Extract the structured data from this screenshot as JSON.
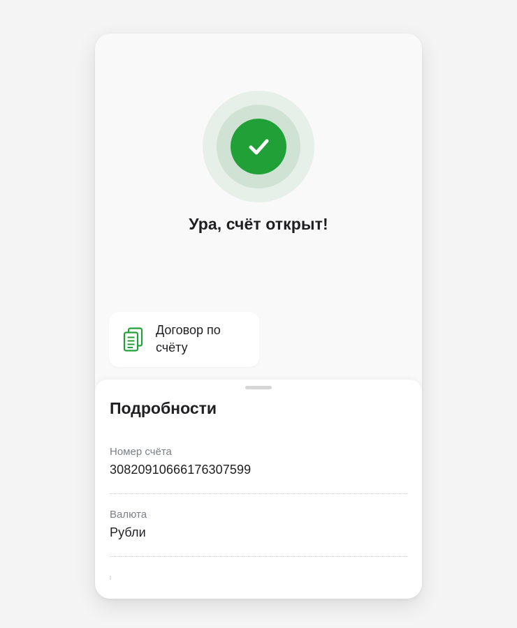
{
  "status": {
    "icon": "check-icon",
    "title": "Ура, счёт открыт!",
    "accent_color": "#21a038"
  },
  "document": {
    "icon": "document-stack-icon",
    "label": "Договор по счёту"
  },
  "details": {
    "title": "Подробности",
    "items": [
      {
        "label": "Номер счёта",
        "value": "30820910666176307599"
      },
      {
        "label": "Валюта",
        "value": "Рубли"
      }
    ]
  }
}
